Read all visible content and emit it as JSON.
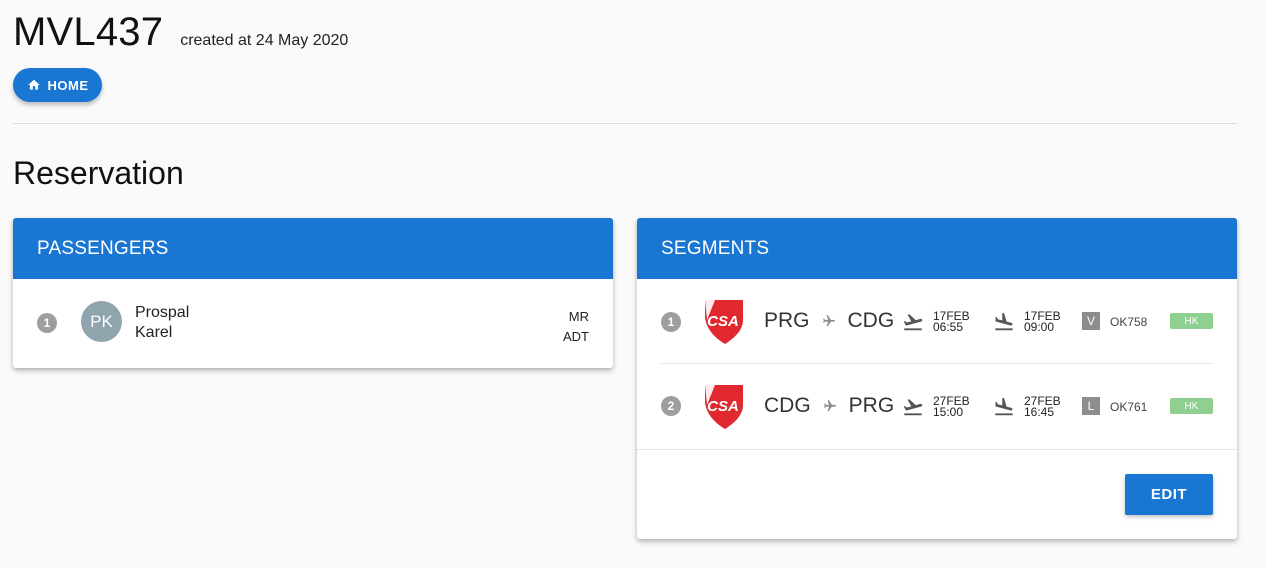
{
  "reservation": {
    "pnr": "MVL437",
    "created": "created at 24 May 2020"
  },
  "nav": {
    "home_label": "HOME"
  },
  "section_title": "Reservation",
  "passengers": {
    "title": "PASSENGERS",
    "items": [
      {
        "number": "1",
        "initials": "PK",
        "last_name": "Prospal",
        "first_name": "Karel",
        "title": "MR",
        "type": "ADT"
      }
    ]
  },
  "segments": {
    "title": "SEGMENTS",
    "edit_label": "EDIT",
    "items": [
      {
        "number": "1",
        "carrier_logo": "csa-logo",
        "from": "PRG",
        "to": "CDG",
        "dep_date": "17FEB",
        "dep_time": "06:55",
        "arr_date": "17FEB",
        "arr_time": "09:00",
        "class": "V",
        "flight": "OK758",
        "status": "HK"
      },
      {
        "number": "2",
        "carrier_logo": "csa-logo",
        "from": "CDG",
        "to": "PRG",
        "dep_date": "27FEB",
        "dep_time": "15:00",
        "arr_date": "27FEB",
        "arr_time": "16:45",
        "class": "L",
        "flight": "OK761",
        "status": "HK"
      }
    ]
  },
  "colors": {
    "primary": "#1976d2",
    "status_ok": "#8fcf8f",
    "badge": "#9e9e9e",
    "avatar": "#90a4ae",
    "logo_red": "#e0282e"
  }
}
